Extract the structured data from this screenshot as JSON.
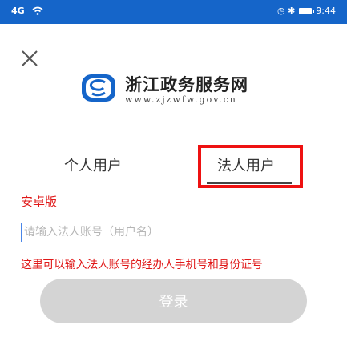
{
  "status_bar": {
    "signal_text": "4G",
    "time": "9:44",
    "status_icons": "◷ ✱"
  },
  "header": {
    "close_icon": "close-icon"
  },
  "brand": {
    "title": "浙江政务服务网",
    "url": "www.zjzwfw.gov.cn",
    "logo_color": "#1565c9"
  },
  "tabs": [
    {
      "label": "个人用户",
      "selected": false
    },
    {
      "label": "法人用户",
      "selected": true
    }
  ],
  "annotations": {
    "android_version": "安卓版",
    "input_hint": "这里可以输入法人账号的经办人手机号和身份证号"
  },
  "account_input": {
    "placeholder": "请输入法人账号（用户名）",
    "value": ""
  },
  "login_button": {
    "label": "登录"
  },
  "colors": {
    "status_bar": "#1565c9",
    "annotation_red": "#e01818",
    "login_disabled": "#d4d4d4"
  }
}
